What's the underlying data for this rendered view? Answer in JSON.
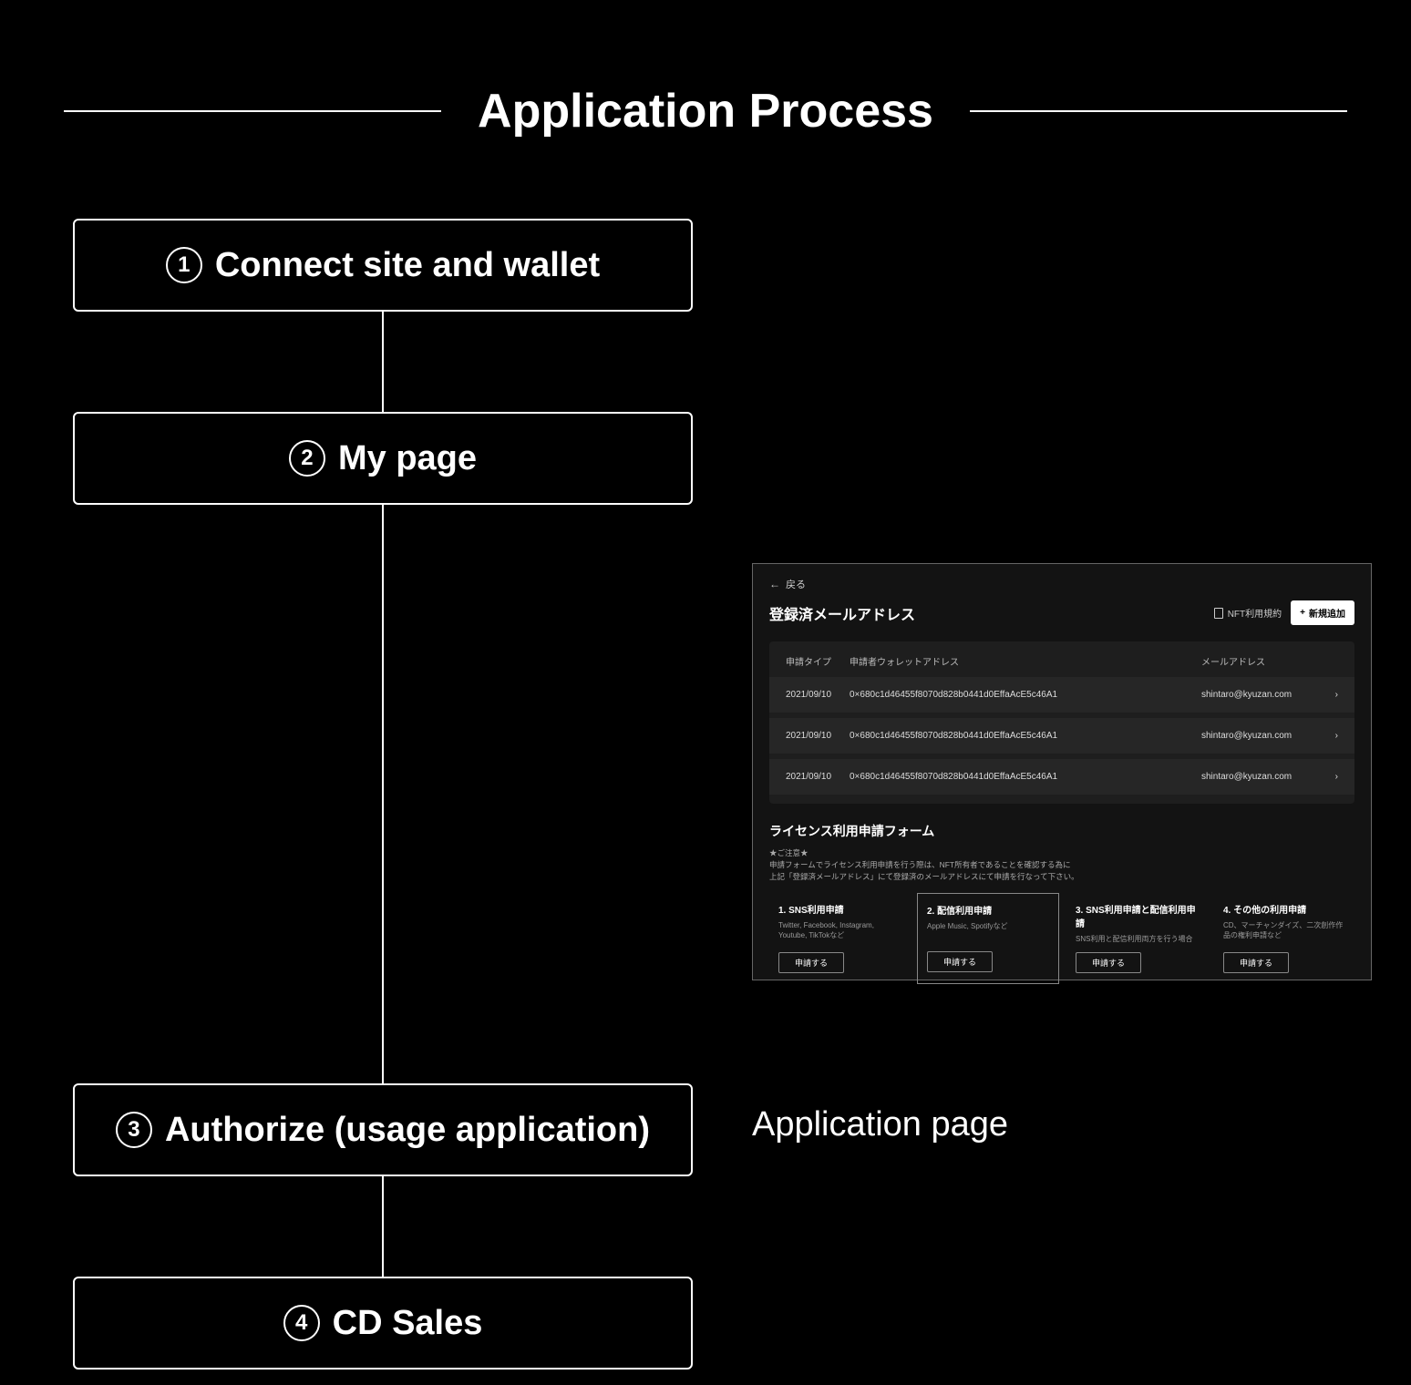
{
  "title": "Application Process",
  "steps": [
    {
      "num": "1",
      "label": "Connect site and wallet"
    },
    {
      "num": "2",
      "label": "My page"
    },
    {
      "num": "3",
      "label": "Authorize (usage application)"
    },
    {
      "num": "4",
      "label": "CD Sales"
    }
  ],
  "side_label": "Application page",
  "mock": {
    "back_label": "戻る",
    "header_title": "登録済メールアドレス",
    "terms_link": "NFT利用規約",
    "add_button": "新規追加",
    "table": {
      "headers": {
        "type": "申請タイプ",
        "addr": "申請者ウォレットアドレス",
        "mail": "メールアドレス"
      },
      "rows": [
        {
          "date": "2021/09/10",
          "addr": "0×680c1d46455f8070d828b0441d0EffaAcE5c46A1",
          "mail": "shintaro@kyuzan.com"
        },
        {
          "date": "2021/09/10",
          "addr": "0×680c1d46455f8070d828b0441d0EffaAcE5c46A1",
          "mail": "shintaro@kyuzan.com"
        },
        {
          "date": "2021/09/10",
          "addr": "0×680c1d46455f8070d828b0441d0EffaAcE5c46A1",
          "mail": "shintaro@kyuzan.com"
        }
      ]
    },
    "form_title": "ライセンス利用申請フォーム",
    "form_notice_line1": "★ご注意★",
    "form_notice_line2": "申請フォームでライセンス利用申請を行う際は、NFT所有者であることを確認する為に",
    "form_notice_line3": "上記「登録済メールアドレス」にて登録済のメールアドレスにて申請を行なって下さい。",
    "cards": [
      {
        "title": "1. SNS利用申請",
        "sub": "Twitter, Facebook, Instagram, Youtube, TikTokなど",
        "btn": "申請する",
        "highlight": false
      },
      {
        "title": "2. 配信利用申請",
        "sub": "Apple Music, Spotifyなど",
        "btn": "申請する",
        "highlight": true
      },
      {
        "title": "3. SNS利用申請と配信利用申請",
        "sub": "SNS利用と配信利用両方を行う場合",
        "btn": "申請する",
        "highlight": false
      },
      {
        "title": "4. その他の利用申請",
        "sub": "CD、マーチャンダイズ、二次創作作品の権利申請など",
        "btn": "申請する",
        "highlight": false
      }
    ]
  }
}
